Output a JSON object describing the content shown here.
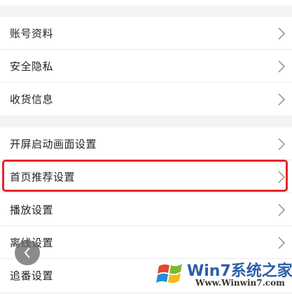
{
  "groups": [
    {
      "items": [
        {
          "label": "账号资料"
        },
        {
          "label": "安全隐私"
        },
        {
          "label": "收货信息"
        }
      ]
    },
    {
      "items": [
        {
          "label": "开屏启动画面设置"
        },
        {
          "label": "首页推荐设置"
        },
        {
          "label": "播放设置"
        },
        {
          "label": "离线设置"
        },
        {
          "label": "追番设置"
        }
      ]
    }
  ],
  "highlight": {
    "color": "#e8232a"
  },
  "icons": {
    "row_arrow": "chevron-right-icon",
    "back": "chevron-left-icon",
    "watermark_logo": "windows-flag-icon"
  },
  "watermark": {
    "title": "Win7系统之家",
    "url": "Www.Winwin7.com"
  }
}
